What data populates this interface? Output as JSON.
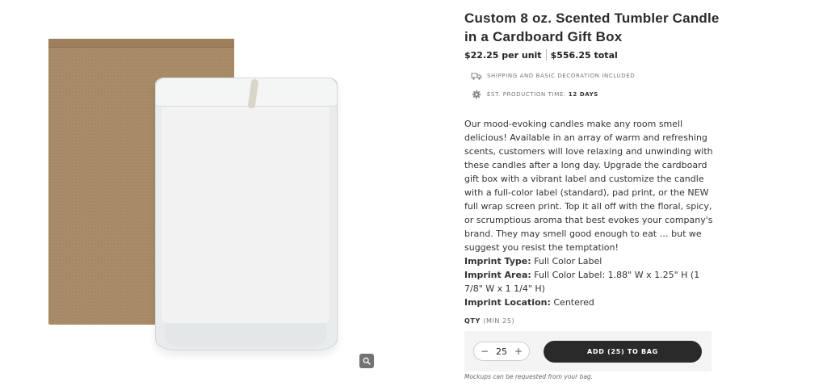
{
  "product": {
    "title": "Custom 8 oz. Scented Tumbler Candle in a Cardboard Gift Box",
    "price_per_unit": "$22.25 per unit",
    "price_total": "$556.25 total"
  },
  "features": [
    {
      "icon": "truck-icon",
      "text": "SHIPPING AND BASIC DECORATION INCLUDED",
      "value": ""
    },
    {
      "icon": "gear-icon",
      "text": "EST. PRODUCTION TIME:",
      "value": "12 DAYS"
    }
  ],
  "description": "Our mood-evoking candles make any room smell delicious! Available in an array of warm and refreshing scents, customers will love relaxing and unwinding with these candles after a long day. Upgrade the cardboard gift box with a vibrant label and customize the candle with a full-color label (standard), pad print, or the NEW full wrap screen print. Top it all off with the floral, spicy, or scrumptious aroma that best evokes your company's brand. They may smell good enough to eat … but we suggest you resist the temptation!",
  "specs": {
    "imprint_type_label": "Imprint Type:",
    "imprint_type_value": "Full Color Label",
    "imprint_area_label": "Imprint Area:",
    "imprint_area_value": "Full Color Label: 1.88\" W x 1.25\" H (1 7/8\" W x 1 1/4\" H)",
    "imprint_location_label": "Imprint Location:",
    "imprint_location_value": "Centered"
  },
  "quantity": {
    "label": "QTY",
    "min_label": "(MIN 25)",
    "value": "25",
    "decrement": "−",
    "increment": "+"
  },
  "cart": {
    "add_label": "ADD (25) TO BAG",
    "note": "Mockups can be requested from your bag."
  },
  "icons": {
    "zoom": "magnifier-icon"
  },
  "colors": {
    "button_dark": "#2a2a2a",
    "panel_bg": "#f4f4f4"
  }
}
